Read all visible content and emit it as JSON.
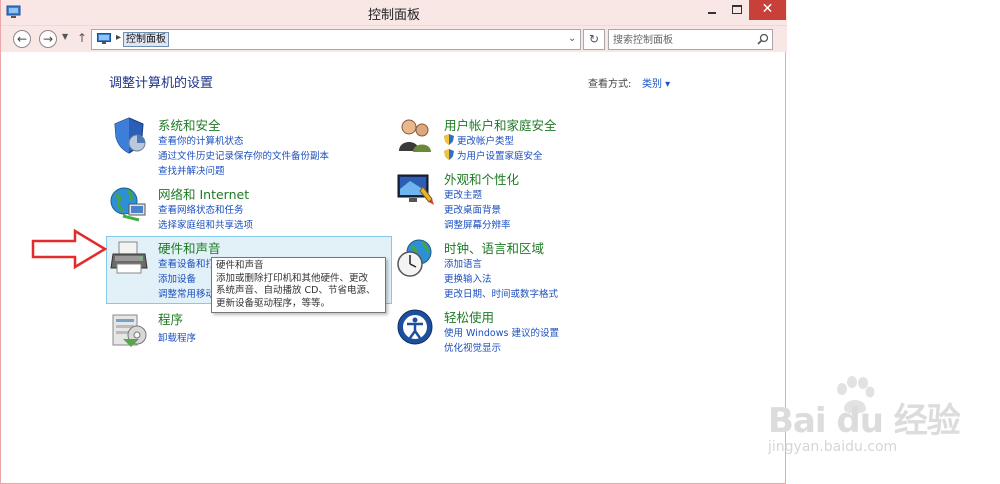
{
  "window": {
    "title": "控制面板",
    "close_glyph": "✕"
  },
  "navbar": {
    "back_glyph": "←",
    "forward_glyph": "→",
    "history_glyph": "▼",
    "up_glyph": "↑",
    "breadcrumb_separator": "▸",
    "breadcrumb": "控制面板",
    "dropdown_glyph": "⌄",
    "refresh_glyph": "↻",
    "search_placeholder": "搜索控制面板"
  },
  "content": {
    "title": "调整计算机的设置",
    "view_label": "查看方式:",
    "view_value": "类别 ▾"
  },
  "categories": [
    {
      "title": "系统和安全",
      "icon": "shield-icon",
      "links": [
        "查看你的计算机状态",
        "通过文件历史记录保存你的文件备份副本",
        "查找并解决问题"
      ]
    },
    {
      "title": "网络和 Internet",
      "icon": "network-icon",
      "links": [
        "查看网络状态和任务",
        "选择家庭组和共享选项"
      ]
    },
    {
      "title": "硬件和声音",
      "icon": "printer-icon",
      "links": [
        "查看设备和打",
        "添加设备",
        "调整常用移动"
      ]
    },
    {
      "title": "程序",
      "icon": "programs-icon",
      "links": [
        "卸载程序"
      ]
    },
    {
      "title": "用户帐户和家庭安全",
      "icon": "users-icon",
      "links": [
        "更改帐户类型",
        "为用户设置家庭安全"
      ]
    },
    {
      "title": "外观和个性化",
      "icon": "appearance-icon",
      "links": [
        "更改主题",
        "更改桌面背景",
        "调整屏幕分辨率"
      ]
    },
    {
      "title": "时钟、语言和区域",
      "icon": "clock-globe-icon",
      "links": [
        "添加语言",
        "更换输入法",
        "更改日期、时间或数字格式"
      ]
    },
    {
      "title": "轻松使用",
      "icon": "ease-of-access-icon",
      "links": [
        "使用 Windows 建议的设置",
        "优化视觉显示"
      ]
    }
  ],
  "tooltip": {
    "lines": [
      "硬件和声音",
      "添加或删除打印机和其他硬件、更改",
      "系统声音、自动播放 CD、节省电源、",
      "更新设备驱动程序，等等。"
    ]
  },
  "watermark": {
    "brand": "Bai du 经验",
    "url": "jingyan.baidu.com"
  },
  "colors": {
    "title_bar": "#f9e7e6",
    "category_title": "#1e7a23",
    "link": "#1c4fbf",
    "heading": "#1e3287",
    "close_button": "#c7413a",
    "hover_bg": "#e2f1f8",
    "arrow": "#e32b2b"
  }
}
